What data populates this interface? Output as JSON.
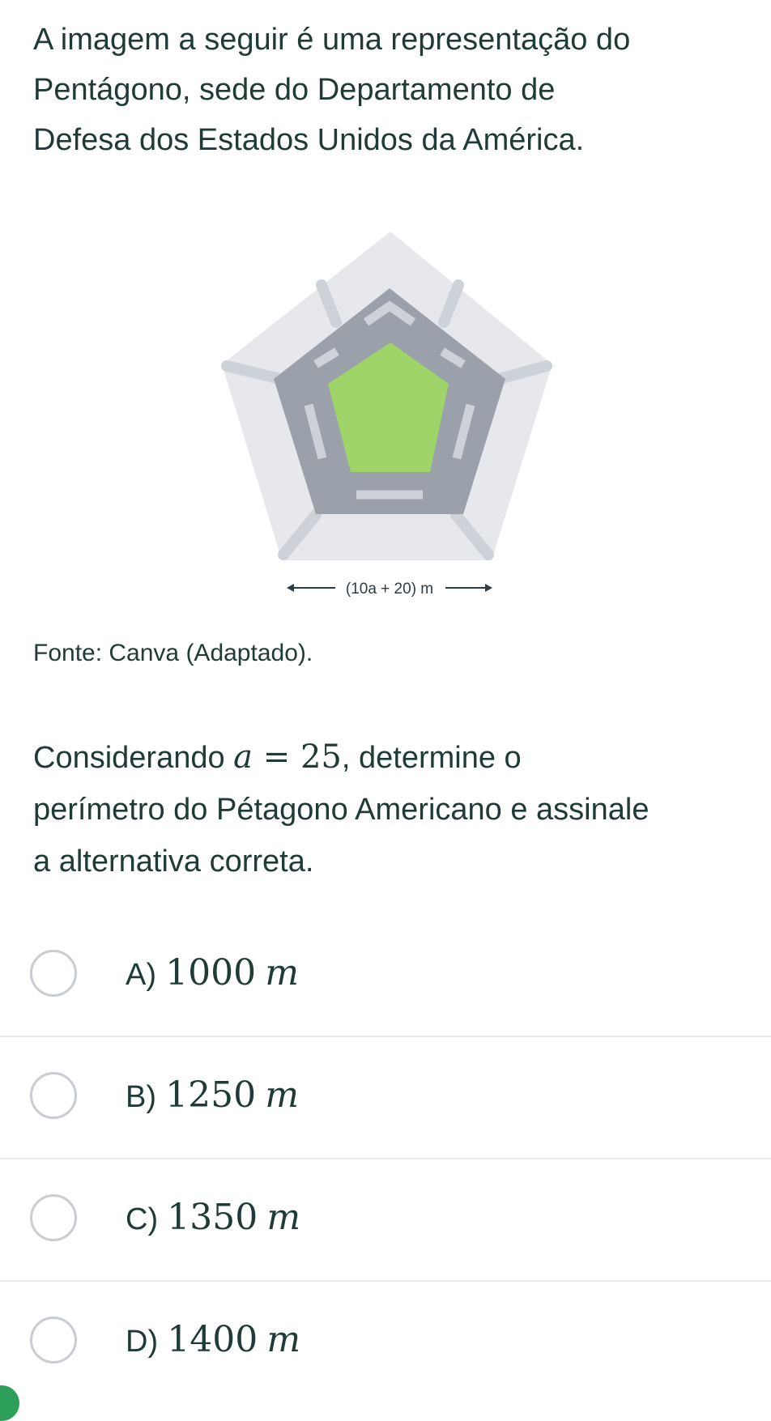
{
  "intro": {
    "lines": [
      "A imagem a seguir é uma representação do",
      "Pentágono, sede do Departamento de",
      "Defesa dos Estados Unidos da América."
    ]
  },
  "figure": {
    "dimension_label": "(10a + 20) m",
    "icon": "pentagon-building-illustration",
    "colors": {
      "outer_ground": "#e6e8ec",
      "building": "#9aa1aa",
      "courtyard": "#9fd468",
      "walkways": "#cdd1d8"
    }
  },
  "source": "Fonte: Canva (Adaptado).",
  "question": {
    "before_math": "Considerando ",
    "math_variable": "a",
    "math_rest": " = 25",
    "after_math_line1": ", determine o",
    "line2": "perímetro do Pétagono Americano e assinale",
    "line3": "a alternativa correta."
  },
  "options": [
    {
      "letter": "A)",
      "value": "1000",
      "unit": "m",
      "selected": false
    },
    {
      "letter": "B)",
      "value": "1250",
      "unit": "m",
      "selected": false
    },
    {
      "letter": "C)",
      "value": "1350",
      "unit": "m",
      "selected": false
    },
    {
      "letter": "D)",
      "value": "1400",
      "unit": "m",
      "selected": false
    }
  ],
  "colors": {
    "text": "#1e3b38",
    "divider": "#e8eaec",
    "radio_border": "#c9cdd2",
    "accent": "#2e9e5b"
  }
}
